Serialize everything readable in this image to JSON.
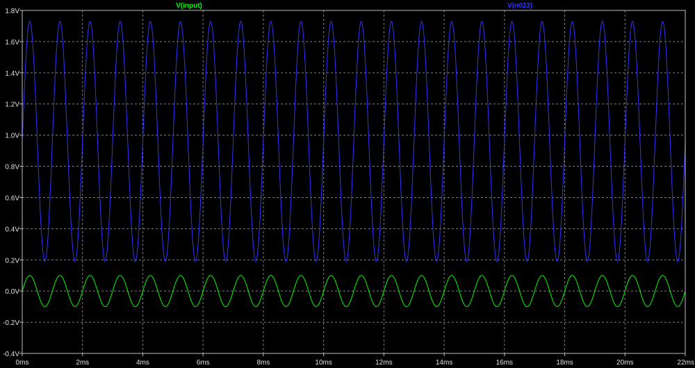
{
  "chart_data": {
    "type": "line",
    "x_unit": "ms",
    "y_unit": "V",
    "xlim": [
      0,
      22
    ],
    "ylim": [
      -0.4,
      1.8
    ],
    "x_ticks": [
      0,
      2,
      4,
      6,
      8,
      10,
      12,
      14,
      16,
      18,
      20,
      22
    ],
    "x_tick_labels": [
      "0ms",
      "2ms",
      "4ms",
      "6ms",
      "8ms",
      "10ms",
      "12ms",
      "14ms",
      "16ms",
      "18ms",
      "20ms",
      "22ms"
    ],
    "y_ticks": [
      -0.4,
      -0.2,
      0.0,
      0.2,
      0.4,
      0.6,
      0.8,
      1.0,
      1.2,
      1.4,
      1.6,
      1.8
    ],
    "y_tick_labels": [
      "-0.4V",
      "-0.2V",
      "0.0V",
      "0.2V",
      "0.4V",
      "0.6V",
      "0.8V",
      "1.0V",
      "1.2V",
      "1.4V",
      "1.6V",
      "1.8V"
    ],
    "grid": true,
    "grid_style": "dashed",
    "background_color": "#000000",
    "axis_color": "#c0c0c0",
    "series": [
      {
        "name": "V(input)",
        "color": "#00ff00",
        "waveform": "sine",
        "frequency_hz": 1000,
        "amplitude_v": 0.1,
        "offset_v": 0.0,
        "phase_deg": 0
      },
      {
        "name": "V(n023)",
        "color": "#3333ff",
        "waveform": "sine",
        "frequency_hz": 1000,
        "amplitude_v": 0.77,
        "offset_v": 0.96,
        "phase_deg": 0
      }
    ]
  }
}
